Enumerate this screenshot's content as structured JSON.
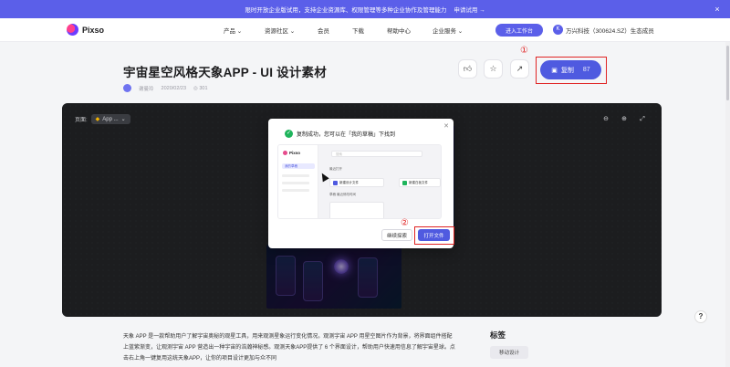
{
  "banner": {
    "text": "限时开放企业版试用，支持企业资源库、权限管理等多种企业协作及管理能力",
    "cta": "申请试用 →",
    "close": "×"
  },
  "nav": {
    "logo": "Pixso",
    "items": [
      "产品 ⌄",
      "资源社区 ⌄",
      "会员",
      "下载",
      "帮助中心",
      "企业服务 ⌄"
    ],
    "workspace_button": "进入工作台",
    "avatar_letter": "K",
    "eco_label": "万兴科技（300624.SZ）生态成员"
  },
  "header": {
    "title": "宇宙星空风格天象APP - UI 设计素材",
    "author": "谢曼玲",
    "date": "2020/02/23",
    "views": "◎ 301",
    "copy_label": "复制",
    "copy_count": "87",
    "mark1": "①",
    "mark2": "②"
  },
  "stage": {
    "page_label": "页面:",
    "page_value": "App ...",
    "tools": [
      "⊖",
      "⊕",
      "⤢"
    ]
  },
  "modal": {
    "message": "复制成功，您可以在「我的草稿」下找到",
    "continue": "继续探索",
    "open": "打开文件",
    "shot": {
      "brand": "Pixso",
      "menu_selected": "我的草稿",
      "search_placeholder": "搜索",
      "recent": "最近打开",
      "card1": "新建设计文件",
      "card2": "新建白板文件",
      "section": "草稿  最近修改时间"
    }
  },
  "description": {
    "text": "天象 APP 是一款帮助用户了解宇宙奥秘的观星工具，用来观测星象运行变化情况。观测宇宙 APP 用星空图片作为背景，将界面组件搭配上蓝紫渐变，让观测宇宙 APP 营造出一种宇宙的浩瀚神秘感。观测天象APP提供了 6 个界面设计，帮助用户快速用信息了解宇宙星球。点击右上角一键复用这统天象APP，让你的项目设计更加与众不同"
  },
  "tags": {
    "title": "标签",
    "items": [
      "移动设计"
    ]
  },
  "help": "?",
  "colors": {
    "accent": "#4f5ae0",
    "banner": "#5b5fe9",
    "annotation": "#e02424",
    "success": "#1fb45c"
  }
}
